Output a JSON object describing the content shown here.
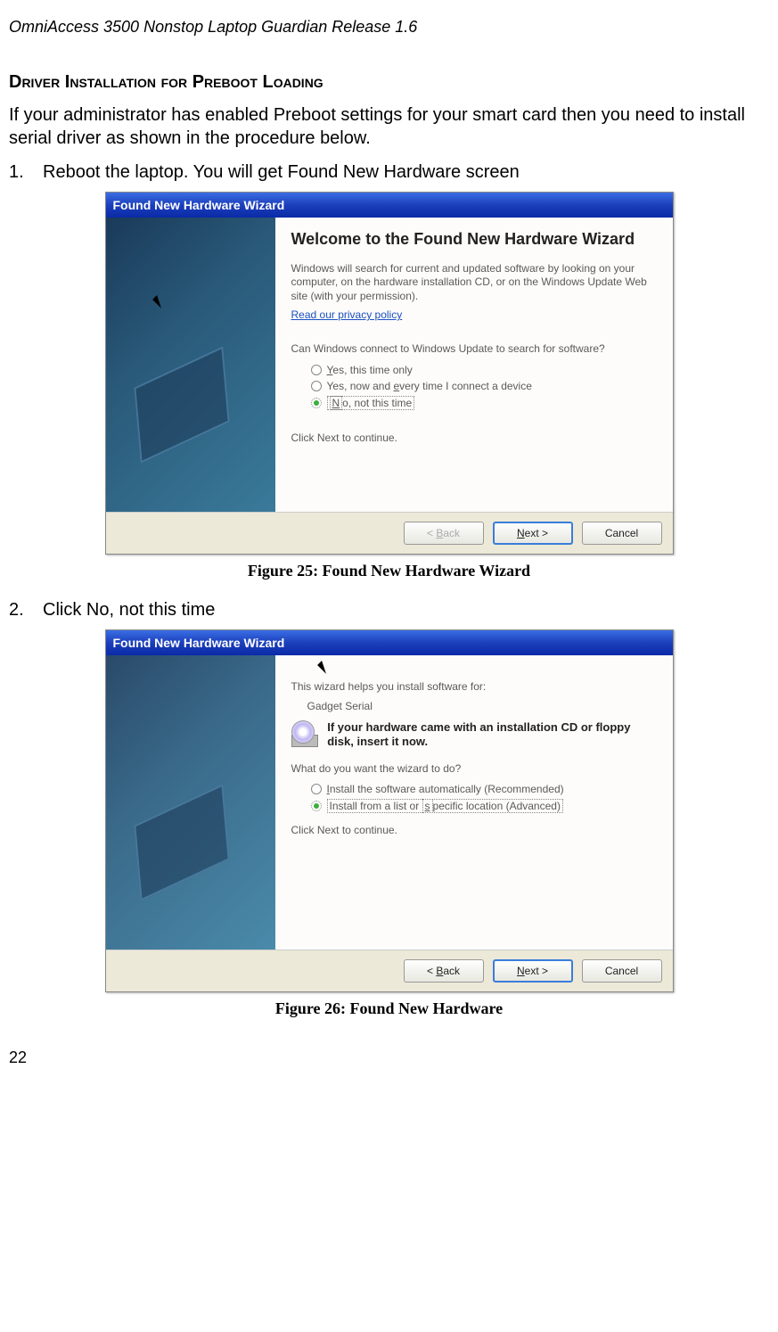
{
  "header": "OmniAccess 3500 Nonstop Laptop Guardian Release 1.6",
  "section_heading": "Driver Installation for Preboot Loading",
  "intro_para": "If your administrator has enabled Preboot settings for your smart card then you need to install serial driver as shown in the procedure below.",
  "steps": {
    "s1_num": "1.",
    "s1_text": "Reboot the laptop. You will get Found New Hardware screen",
    "s2_num": "2.",
    "s2_text": "Click No, not this time"
  },
  "dialog1": {
    "title": "Found New Hardware Wizard",
    "heading": "Welcome to the Found New Hardware Wizard",
    "para1": "Windows will search for current and updated software by looking on your computer, on the hardware installation CD, or on the Windows Update Web site (with your permission).",
    "privacy_link": "Read our privacy policy",
    "question": "Can Windows connect to Windows Update to search for software?",
    "opt1": "Yes, this time only",
    "opt2": "Yes, now and every time I connect a device",
    "opt3": "No, not this time",
    "continue": "Click Next to continue.",
    "back": "< Back",
    "next": "Next >",
    "cancel": "Cancel"
  },
  "caption1": "Figure 25: Found New Hardware Wizard",
  "dialog2": {
    "title": "Found New Hardware Wizard",
    "para1": "This wizard helps you install software for:",
    "device": "Gadget Serial",
    "cd_text": "If your hardware came with an installation CD or floppy disk, insert it now.",
    "question": "What do you want the wizard to do?",
    "opt1": "Install the software automatically (Recommended)",
    "opt2": "Install from a list or specific location (Advanced)",
    "continue": "Click Next to continue.",
    "back": "< Back",
    "next": "Next >",
    "cancel": "Cancel"
  },
  "caption2": "Figure 26: Found New Hardware",
  "page_number": "22"
}
